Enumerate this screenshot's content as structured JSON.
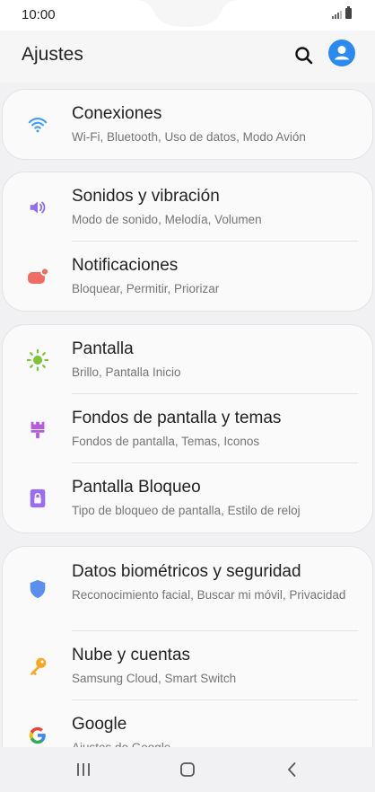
{
  "status": {
    "time": "10:00"
  },
  "header": {
    "title": "Ajustes"
  },
  "groups": [
    [
      {
        "title": "Conexiones",
        "subtitle": "Wi-Fi, Bluetooth, Uso de datos, Modo Avión",
        "icon": "wifi-icon",
        "color": "#3f9cf5"
      }
    ],
    [
      {
        "title": "Sonidos y vibración",
        "subtitle": "Modo de sonido, Melodía, Volumen",
        "icon": "volume-icon",
        "color": "#8f6ee8"
      },
      {
        "title": "Notificaciones",
        "subtitle": "Bloquear, Permitir, Priorizar",
        "icon": "notification-icon",
        "color": "#ef6d62"
      }
    ],
    [
      {
        "title": "Pantalla",
        "subtitle": "Brillo, Pantalla Inicio",
        "icon": "brightness-icon",
        "color": "#7cc43a"
      },
      {
        "title": "Fondos de pantalla y temas",
        "subtitle": "Fondos de pantalla, Temas, Iconos",
        "icon": "theme-brush-icon",
        "color": "#b35ed8"
      },
      {
        "title": "Pantalla Bloqueo",
        "subtitle": "Tipo de bloqueo de pantalla, Estilo de reloj",
        "icon": "lock-icon",
        "color": "#9a6cf0"
      }
    ],
    [
      {
        "title": "Datos biométricos y seguridad",
        "subtitle": "Reconocimiento facial, Buscar mi móvil, Privacidad",
        "icon": "shield-icon",
        "color": "#5a8ff0"
      },
      {
        "title": "Nube y cuentas",
        "subtitle": "Samsung Cloud, Smart Switch",
        "icon": "key-icon",
        "color": "#f5a623"
      },
      {
        "title": "Google",
        "subtitle": "Ajustes de Google",
        "icon": "google-icon",
        "color": "#4285f4"
      }
    ]
  ],
  "nav": {
    "recents": "recents-icon",
    "home": "home-icon",
    "back": "back-icon"
  }
}
